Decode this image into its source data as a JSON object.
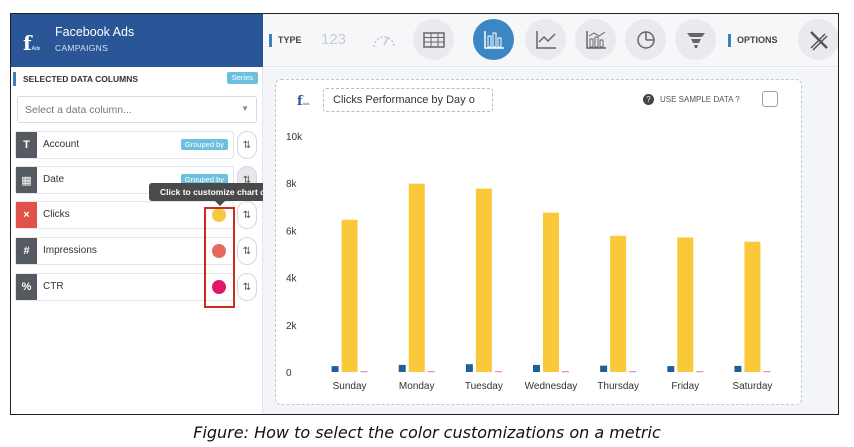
{
  "app": {
    "title": "Facebook Ads",
    "subtitle": "CAMPAIGNS"
  },
  "left_panel": {
    "header_label": "SELECTED DATA COLUMNS",
    "header_badge": "Series",
    "select_placeholder": "Select a data column...",
    "rows": [
      {
        "icon_text": "T",
        "label": "Account",
        "badge": "Grouped by",
        "icon_color": "#555a60"
      },
      {
        "icon_text": "▦",
        "label": "Date",
        "badge": "Grouped by",
        "icon_color": "#555a60"
      },
      {
        "icon_text": "×",
        "label": "Clicks",
        "icon_color": "#e0524a",
        "dot_color": "#f7c842"
      },
      {
        "icon_text": "#",
        "label": "Impressions",
        "icon_color": "#555a60",
        "dot_color": "#e8695a"
      },
      {
        "icon_text": "%",
        "label": "CTR",
        "icon_color": "#555a60",
        "dot_color": "#e0166a"
      }
    ],
    "tooltip": "Click to customize chart color"
  },
  "toolbar": {
    "type_label": "TYPE",
    "number_label": "123",
    "options_label": "OPTIONS",
    "buttons": [
      "number-icon",
      "gauge-icon",
      "table-icon",
      "bar-chart-icon",
      "line-chart-icon",
      "combo-chart-icon",
      "pie-chart-icon",
      "funnel-icon",
      "wrench-pencil-icon"
    ],
    "active": "bar-chart-icon"
  },
  "chart_card": {
    "title": "Clicks Performance by Day o",
    "sample_label": "USE SAMPLE DATA ?"
  },
  "chart_data": {
    "type": "bar",
    "categories": [
      "Sunday",
      "Monday",
      "Tuesday",
      "Wednesday",
      "Thursday",
      "Friday",
      "Saturday"
    ],
    "series": [
      {
        "values": [
          250,
          300,
          330,
          300,
          270,
          250,
          260
        ],
        "color": "#1f5f99"
      },
      {
        "values": [
          6450,
          7980,
          7770,
          6750,
          5770,
          5700,
          5520
        ],
        "color": "#f9c93a"
      },
      {
        "values": [
          20,
          20,
          20,
          20,
          20,
          20,
          20
        ],
        "color": "#e0166a"
      }
    ],
    "yticks": [
      "0",
      "2k",
      "4k",
      "6k",
      "8k",
      "10k"
    ],
    "ylim": [
      0,
      10000
    ],
    "grid": false
  },
  "caption": "Figure: How to select the color customizations on a metric"
}
